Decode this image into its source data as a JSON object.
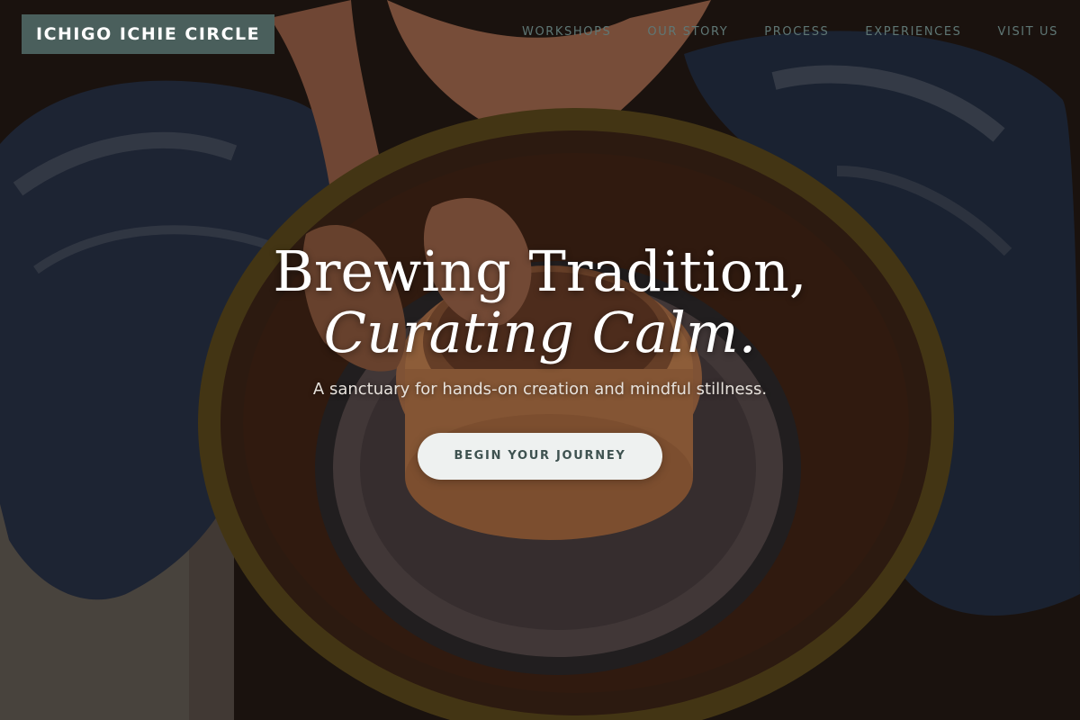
{
  "brand": {
    "logo_text": "ICHIGO ICHIE CIRCLE"
  },
  "nav": {
    "items": [
      {
        "label": "WORKSHOPS"
      },
      {
        "label": "OUR STORY"
      },
      {
        "label": "PROCESS"
      },
      {
        "label": "EXPERIENCES"
      },
      {
        "label": "VISIT US"
      }
    ]
  },
  "hero": {
    "headline_line1": "Brewing Tradition,",
    "headline_line2": "Curating Calm.",
    "subtitle": "A sanctuary for hands-on creation and mindful stillness.",
    "cta_label": "BEGIN YOUR JOURNEY"
  },
  "colors": {
    "logo_background": "#4a5f5c",
    "nav_text": "#5f7775",
    "cta_background": "#eef1f0",
    "cta_text": "#3e5250"
  }
}
